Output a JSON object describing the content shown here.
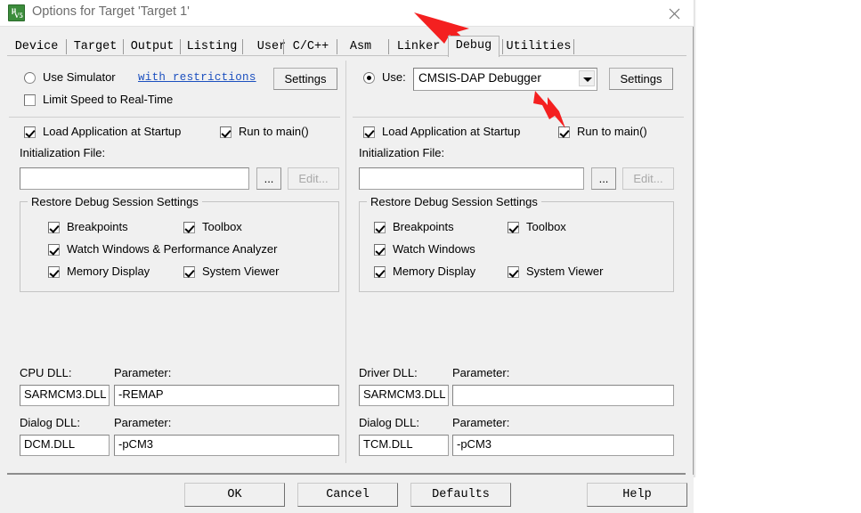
{
  "window": {
    "title": "Options for Target 'Target 1'",
    "icon": "uvision-icon",
    "icon_glyph_top": "μ",
    "icon_glyph_bottom": "V5",
    "close_label": "×"
  },
  "tabs": [
    {
      "label": "Device",
      "active": false
    },
    {
      "label": "Target",
      "active": false
    },
    {
      "label": "Output",
      "active": false
    },
    {
      "label": "Listing",
      "active": false
    },
    {
      "label": "User",
      "active": false
    },
    {
      "label": "C/C++",
      "active": false
    },
    {
      "label": "Asm",
      "active": false
    },
    {
      "label": "Linker",
      "active": false
    },
    {
      "label": "Debug",
      "active": true
    },
    {
      "label": "Utilities",
      "active": false
    }
  ],
  "left_panel": {
    "use_simulator_label": "Use Simulator",
    "use_simulator_checked": false,
    "restrictions_link": "with restrictions",
    "settings_button": "Settings",
    "limit_speed_label": "Limit Speed to Real-Time",
    "limit_speed_checked": false,
    "load_app_label": "Load Application at Startup",
    "load_app_checked": true,
    "run_to_main_label": "Run to main()",
    "run_to_main_checked": true,
    "init_file_label": "Initialization File:",
    "init_file_value": "",
    "browse_button": "...",
    "edit_button": "Edit...",
    "edit_button_enabled": false,
    "group_title": "Restore Debug Session Settings",
    "restore": [
      {
        "label": "Breakpoints",
        "checked": true
      },
      {
        "label": "Toolbox",
        "checked": true
      },
      {
        "label": "Watch Windows & Performance Analyzer",
        "checked": true
      },
      {
        "label": "Memory Display",
        "checked": true
      },
      {
        "label": "System Viewer",
        "checked": true
      }
    ],
    "cpu_dll_label": "CPU DLL:",
    "cpu_dll_value": "SARMCM3.DLL",
    "cpu_param_label": "Parameter:",
    "cpu_param_value": "-REMAP",
    "dialog_dll_label": "Dialog DLL:",
    "dialog_dll_value": "DCM.DLL",
    "dialog_param_label": "Parameter:",
    "dialog_param_value": "-pCM3"
  },
  "right_panel": {
    "use_label": "Use:",
    "use_checked": true,
    "debugger_selected": "CMSIS-DAP Debugger",
    "settings_button": "Settings",
    "load_app_label": "Load Application at Startup",
    "load_app_checked": true,
    "run_to_main_label": "Run to main()",
    "run_to_main_checked": true,
    "init_file_label": "Initialization File:",
    "init_file_value": "",
    "browse_button": "...",
    "edit_button": "Edit...",
    "edit_button_enabled": false,
    "group_title": "Restore Debug Session Settings",
    "restore": [
      {
        "label": "Breakpoints",
        "checked": true
      },
      {
        "label": "Toolbox",
        "checked": true
      },
      {
        "label": "Watch Windows",
        "checked": true
      },
      {
        "label": "Memory Display",
        "checked": true
      },
      {
        "label": "System Viewer",
        "checked": true
      }
    ],
    "driver_dll_label": "Driver DLL:",
    "driver_dll_value": "SARMCM3.DLL",
    "driver_param_label": "Parameter:",
    "driver_param_value": "",
    "dialog_dll_label": "Dialog DLL:",
    "dialog_dll_value": "TCM.DLL",
    "dialog_param_label": "Parameter:",
    "dialog_param_value": "-pCM3"
  },
  "footer": {
    "ok": "OK",
    "cancel": "Cancel",
    "defaults": "Defaults",
    "help": "Help"
  },
  "annotations": {
    "arrow_color": "#f42020",
    "arrow_1_target": "debug-tab",
    "arrow_2_target": "debugger-combo"
  }
}
